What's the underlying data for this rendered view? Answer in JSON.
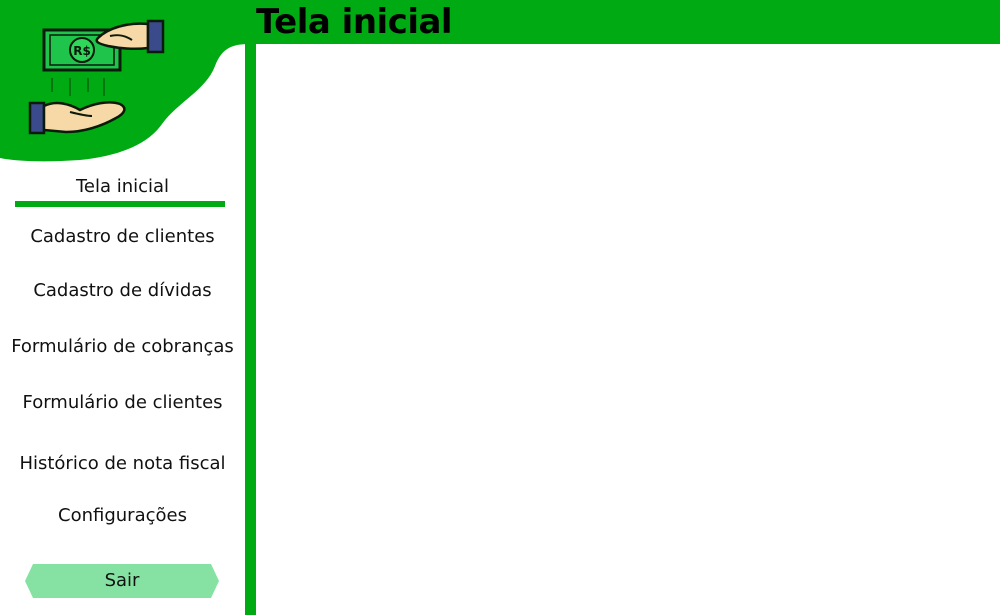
{
  "header": {
    "title": "Tela inicial"
  },
  "logo": {
    "note_text": "R$"
  },
  "colors": {
    "brand": "#00aa13",
    "button": "#86e2a2",
    "money": "#1fc44a",
    "skin": "#f6d9a6",
    "cuff": "#3a4a8a"
  },
  "nav": {
    "items": [
      {
        "label": "Tela inicial",
        "active": true
      },
      {
        "label": "Cadastro de clientes"
      },
      {
        "label": "Cadastro de dívidas"
      },
      {
        "label": "Formulário de cobranças"
      },
      {
        "label": "Formulário de clientes"
      },
      {
        "label": "Histórico de nota fiscal"
      },
      {
        "label": "Configurações"
      }
    ],
    "logout_label": "Sair"
  }
}
